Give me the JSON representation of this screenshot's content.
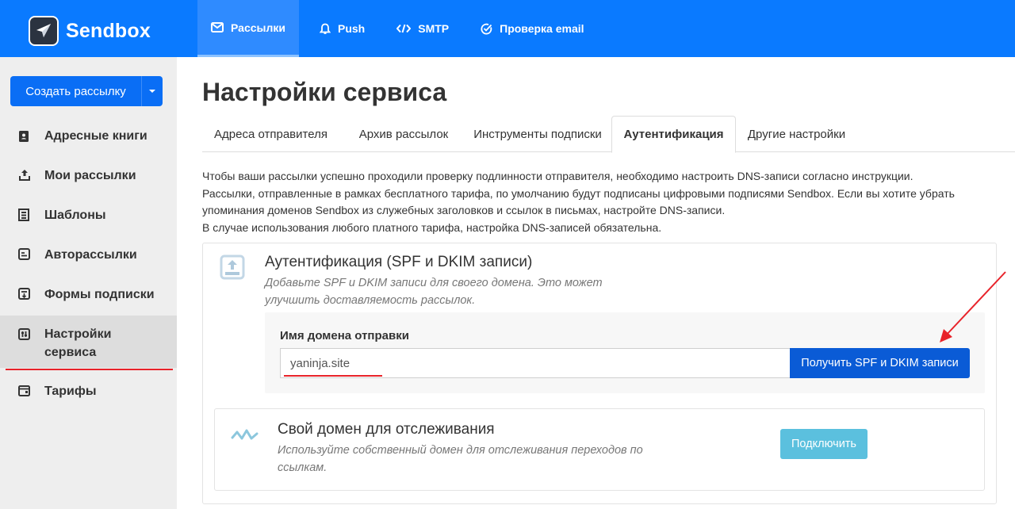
{
  "brand": {
    "name": "Sendbox"
  },
  "topnav": [
    {
      "label": "Рассылки",
      "icon": "envelope-icon",
      "active": true
    },
    {
      "label": "Push",
      "icon": "bell-icon",
      "active": false
    },
    {
      "label": "SMTP",
      "icon": "code-icon",
      "active": false
    },
    {
      "label": "Проверка email",
      "icon": "check-circle-icon",
      "active": false
    }
  ],
  "sidebar": {
    "create_button": "Создать рассылку",
    "items": [
      {
        "label": "Адресные книги",
        "icon": "address-book-icon"
      },
      {
        "label": "Мои рассылки",
        "icon": "upload-icon"
      },
      {
        "label": "Шаблоны",
        "icon": "template-icon"
      },
      {
        "label": "Авторассылки",
        "icon": "autoresponder-icon"
      },
      {
        "label": "Формы подписки",
        "icon": "form-icon"
      },
      {
        "label_line1": "Настройки",
        "label_line2": "сервиса",
        "icon": "sliders-icon",
        "active": true
      },
      {
        "label": "Тарифы",
        "icon": "wallet-icon"
      }
    ]
  },
  "main": {
    "title": "Настройки сервиса",
    "tabs": [
      {
        "label": "Адреса отправителя"
      },
      {
        "label": "Архив рассылок"
      },
      {
        "label": "Инструменты подписки"
      },
      {
        "label": "Аутентификация",
        "active": true
      },
      {
        "label": "Другие настройки"
      }
    ],
    "intro": [
      "Чтобы ваши рассылки успешно проходили проверку подлинности отправителя, необходимо настроить DNS-записи согласно инструкции.",
      "Рассылки, отправленные в рамках бесплатного тарифа, по умолчанию будут подписаны цифровыми подписями Sendbox. Если вы хотите убрать",
      "упоминания доменов Sendbox из служебных заголовков и ссылок в письмах, настройте DNS-записи.",
      "В случае использования любого платного тарифа, настройка DNS-записей обязательна."
    ],
    "auth_card": {
      "title": "Аутентификация (SPF и DKIM записи)",
      "desc_line1": "Добавьте SPF и DKIM записи для своего домена. Это может",
      "desc_line2": "улучшить доставляемость рассылок.",
      "field_label": "Имя домена отправки",
      "field_value": "yaninja.site",
      "button": "Получить SPF и DKIM записи"
    },
    "tracking_card": {
      "title": "Свой домен для отслеживания",
      "desc_line1": "Используйте собственный домен для отслеживания переходов по",
      "desc_line2": "ссылкам.",
      "button": "Подключить"
    }
  },
  "colors": {
    "topbar": "#0a7aff",
    "primary_button": "#0a6ef5",
    "get_records_button": "#0a5bd6",
    "connect_button": "#5bc0de",
    "annotation_red": "#e8232a"
  }
}
